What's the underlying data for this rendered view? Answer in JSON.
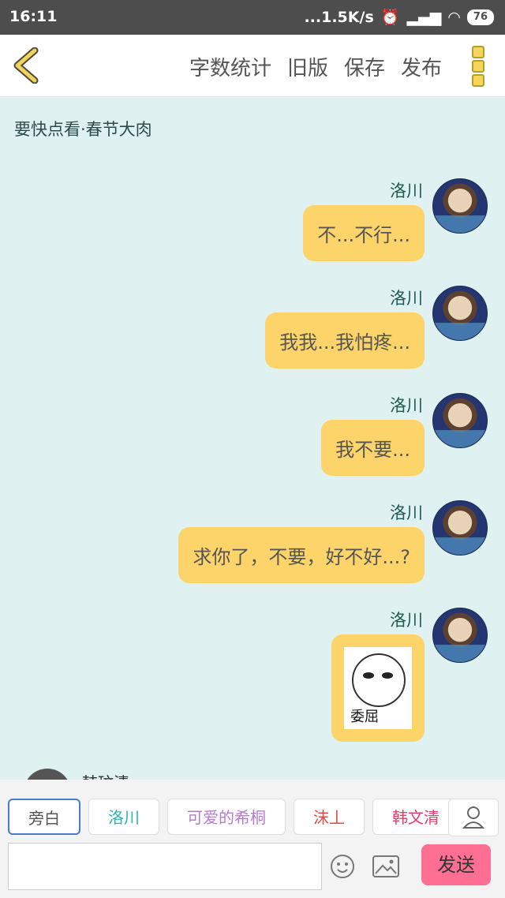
{
  "status_bar": {
    "time": "16:11",
    "network_speed": "...1.5K/s",
    "battery": "76"
  },
  "toolbar": {
    "word_count": "字数统计",
    "old_version": "旧版",
    "save": "保存",
    "publish": "发布"
  },
  "story": {
    "title": "要快点看·春节大肉"
  },
  "messages": [
    {
      "sender": "洛川",
      "text": "不...不行..."
    },
    {
      "sender": "洛川",
      "text": "我我...我怕疼..."
    },
    {
      "sender": "洛川",
      "text": "我不要..."
    },
    {
      "sender": "洛川",
      "text": "求你了，不要，好不好...?"
    },
    {
      "sender": "洛川",
      "sticker_caption": "委屈"
    }
  ],
  "next_message": {
    "sender": "韩玟清"
  },
  "characters": [
    {
      "label": "旁白",
      "color": "#555555"
    },
    {
      "label": "洛川",
      "color": "#2bb5b0"
    },
    {
      "label": "可爱的希桐",
      "color": "#b57bd0"
    },
    {
      "label": "沫丄",
      "color": "#e04848"
    },
    {
      "label": "韩文清",
      "color": "#e0406b"
    }
  ],
  "composer": {
    "send_label": "发送",
    "placeholder": ""
  }
}
